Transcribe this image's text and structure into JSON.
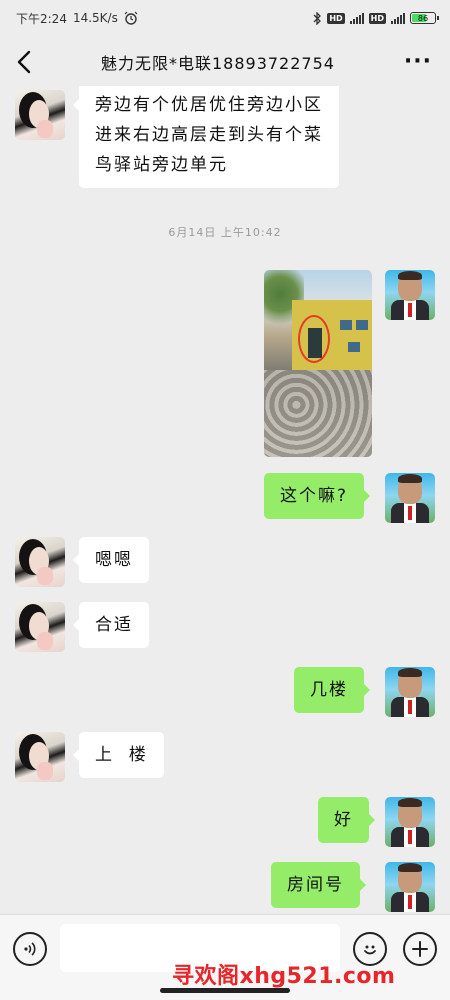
{
  "status_bar": {
    "time": "下午2:24",
    "network_speed": "14.5K/s",
    "battery_level": "86",
    "hd_label": "HD"
  },
  "header": {
    "title": "魅力无限*电联18893722754",
    "more_label": "···"
  },
  "messages": [
    {
      "side": "left",
      "text": "旁边有个优居优住旁边小区\n进来右边高层走到头有个菜\n鸟驿站旁边单元"
    },
    {
      "side": "center",
      "timestamp": "6月14日 上午10:42"
    },
    {
      "side": "right",
      "type": "image"
    },
    {
      "side": "right",
      "text": "这个嘛?"
    },
    {
      "side": "left",
      "text": "嗯嗯"
    },
    {
      "side": "left",
      "text": "合适"
    },
    {
      "side": "right",
      "text": "几楼"
    },
    {
      "side": "left",
      "text": "上  楼"
    },
    {
      "side": "right",
      "text": "好"
    },
    {
      "side": "right",
      "text": "房间号"
    }
  ],
  "input": {
    "value": "",
    "placeholder": ""
  },
  "watermark": "寻欢阁xhg521.com",
  "colors": {
    "background": "#ededed",
    "bubble_self": "#95ec69",
    "bubble_other": "#ffffff",
    "watermark": "#e8262a"
  },
  "icons": {
    "back": "chevron-left-icon",
    "more": "more-dots-icon",
    "voice": "voice-icon",
    "emoji": "emoji-icon",
    "plus": "plus-icon"
  }
}
